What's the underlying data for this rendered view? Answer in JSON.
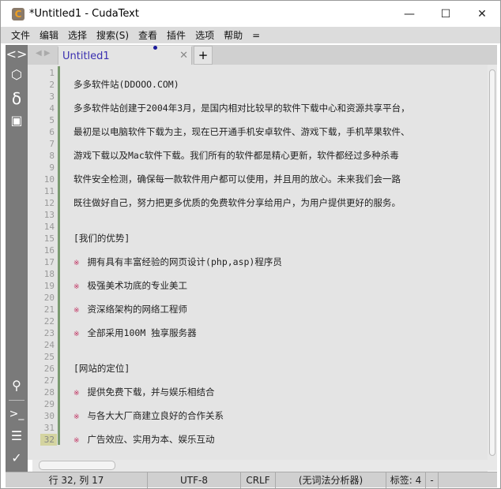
{
  "window": {
    "title": "*Untitled1 - CudaText",
    "app_icon": "C",
    "minimize": "—",
    "maximize": "☐",
    "close": "✕"
  },
  "menu": [
    "文件",
    "编辑",
    "选择",
    "搜索(S)",
    "查看",
    "插件",
    "选项",
    "帮助",
    "="
  ],
  "tabs": [
    {
      "label": "Untitled1",
      "close": "✕"
    }
  ],
  "tab_add": "+",
  "lines": [
    {
      "n": "1",
      "t": ""
    },
    {
      "n": "2",
      "t": "多多软件站(DDOOO.COM)"
    },
    {
      "n": "3",
      "t": ""
    },
    {
      "n": "4",
      "t": "多多软件站创建于2004年3月，是国内相对比较早的软件下载中心和资源共享平台，"
    },
    {
      "n": "5",
      "t": ""
    },
    {
      "n": "6",
      "t": "最初是以电脑软件下载为主，现在已开通手机安卓软件、游戏下载，手机苹果软件、"
    },
    {
      "n": "7",
      "t": ""
    },
    {
      "n": "8",
      "t": "游戏下载以及Mac软件下载。我们所有的软件都是精心更新，软件都经过多种杀毒"
    },
    {
      "n": "9",
      "t": ""
    },
    {
      "n": "10",
      "t": "软件安全检测，确保每一款软件用户都可以使用，并且用的放心。未来我们会一路"
    },
    {
      "n": "11",
      "t": ""
    },
    {
      "n": "12",
      "t": "既往做好自己，努力把更多优质的免费软件分享给用户，为用户提供更好的服务。"
    },
    {
      "n": "13",
      "t": ""
    },
    {
      "n": "14",
      "t": ""
    },
    {
      "n": "15",
      "t": "[我们的优势]"
    },
    {
      "n": "16",
      "t": ""
    },
    {
      "n": "17",
      "b": "※",
      "t": "拥有具有丰富经验的网页设计(php,asp)程序员"
    },
    {
      "n": "18",
      "t": ""
    },
    {
      "n": "19",
      "b": "※",
      "t": "极强美术功底的专业美工"
    },
    {
      "n": "20",
      "t": ""
    },
    {
      "n": "21",
      "b": "※",
      "t": "资深络架构的网络工程师"
    },
    {
      "n": "22",
      "t": ""
    },
    {
      "n": "23",
      "b": "※",
      "t": "全部采用100M 独享服务器"
    },
    {
      "n": "24",
      "t": ""
    },
    {
      "n": "25",
      "t": ""
    },
    {
      "n": "26",
      "t": "[网站的定位]"
    },
    {
      "n": "27",
      "t": ""
    },
    {
      "n": "28",
      "b": "※",
      "t": "提供免费下载，并与娱乐相结合"
    },
    {
      "n": "29",
      "t": ""
    },
    {
      "n": "30",
      "b": "※",
      "t": "与各大大厂商建立良好的合作关系"
    },
    {
      "n": "31",
      "t": ""
    },
    {
      "n": "32",
      "b": "※",
      "t": "广告效应、实用为本、娱乐互动"
    }
  ],
  "current_line": "32",
  "status": {
    "position": "行 32, 列 17",
    "encoding": "UTF-8",
    "line_ending": "CRLF",
    "lexer": "(无词法分析器)",
    "tab_size": "标签: 4",
    "extra": "-"
  }
}
